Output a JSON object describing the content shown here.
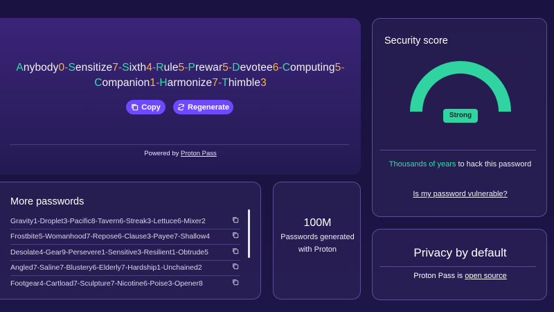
{
  "generator": {
    "password_line1": [
      [
        "Anybody",
        "0",
        "-"
      ],
      [
        "Sensitize",
        "7",
        "-"
      ],
      [
        "Sixth",
        "4",
        "-"
      ],
      [
        "Rule",
        "5",
        "-"
      ],
      [
        "Prewar",
        "5",
        "-"
      ],
      [
        "Devotee",
        "6",
        "-"
      ],
      [
        "Computing",
        "5",
        "-"
      ]
    ],
    "password_line2": [
      [
        "Companion",
        "1",
        "-"
      ],
      [
        "Harmonize",
        "7",
        "-"
      ],
      [
        "Thimble",
        "3",
        ""
      ]
    ],
    "copy_label": "Copy",
    "regenerate_label": "Regenerate",
    "powered_prefix": "Powered by",
    "powered_link": "Proton Pass"
  },
  "score": {
    "title": "Security score",
    "rating": "Strong",
    "rating_level": 1.0,
    "crack_time": "Thousands of years",
    "crack_suffix": "to hack this password",
    "vulnerable_link": "Is my password vulnerable?"
  },
  "more": {
    "title": "More passwords",
    "items": [
      "Gravity1-Droplet3-Pacific8-Tavern6-Streak3-Lettuce6-Mixer2",
      "Frostbite5-Womanhood7-Repose6-Clause3-Payee7-Shallow4",
      "Desolate4-Gear9-Persevere1-Sensitive3-Resilient1-Obtrude5",
      "Angled7-Saline7-Blustery6-Elderly7-Hardship1-Unchained2",
      "Footgear4-Cartload7-Sculpture7-Nicotine6-Poise3-Opener8"
    ]
  },
  "stat": {
    "number": "100M",
    "text": "Passwords generated with Proton"
  },
  "privacy": {
    "title": "Privacy by default",
    "text_prefix": "Proton Pass is",
    "link": "open source"
  },
  "colors": {
    "accent": "#6d4aff",
    "word_initial": "#2ee0a8",
    "digit": "#ffb52e",
    "separator": "#f26dcf",
    "gauge": "#2fd4a0"
  }
}
